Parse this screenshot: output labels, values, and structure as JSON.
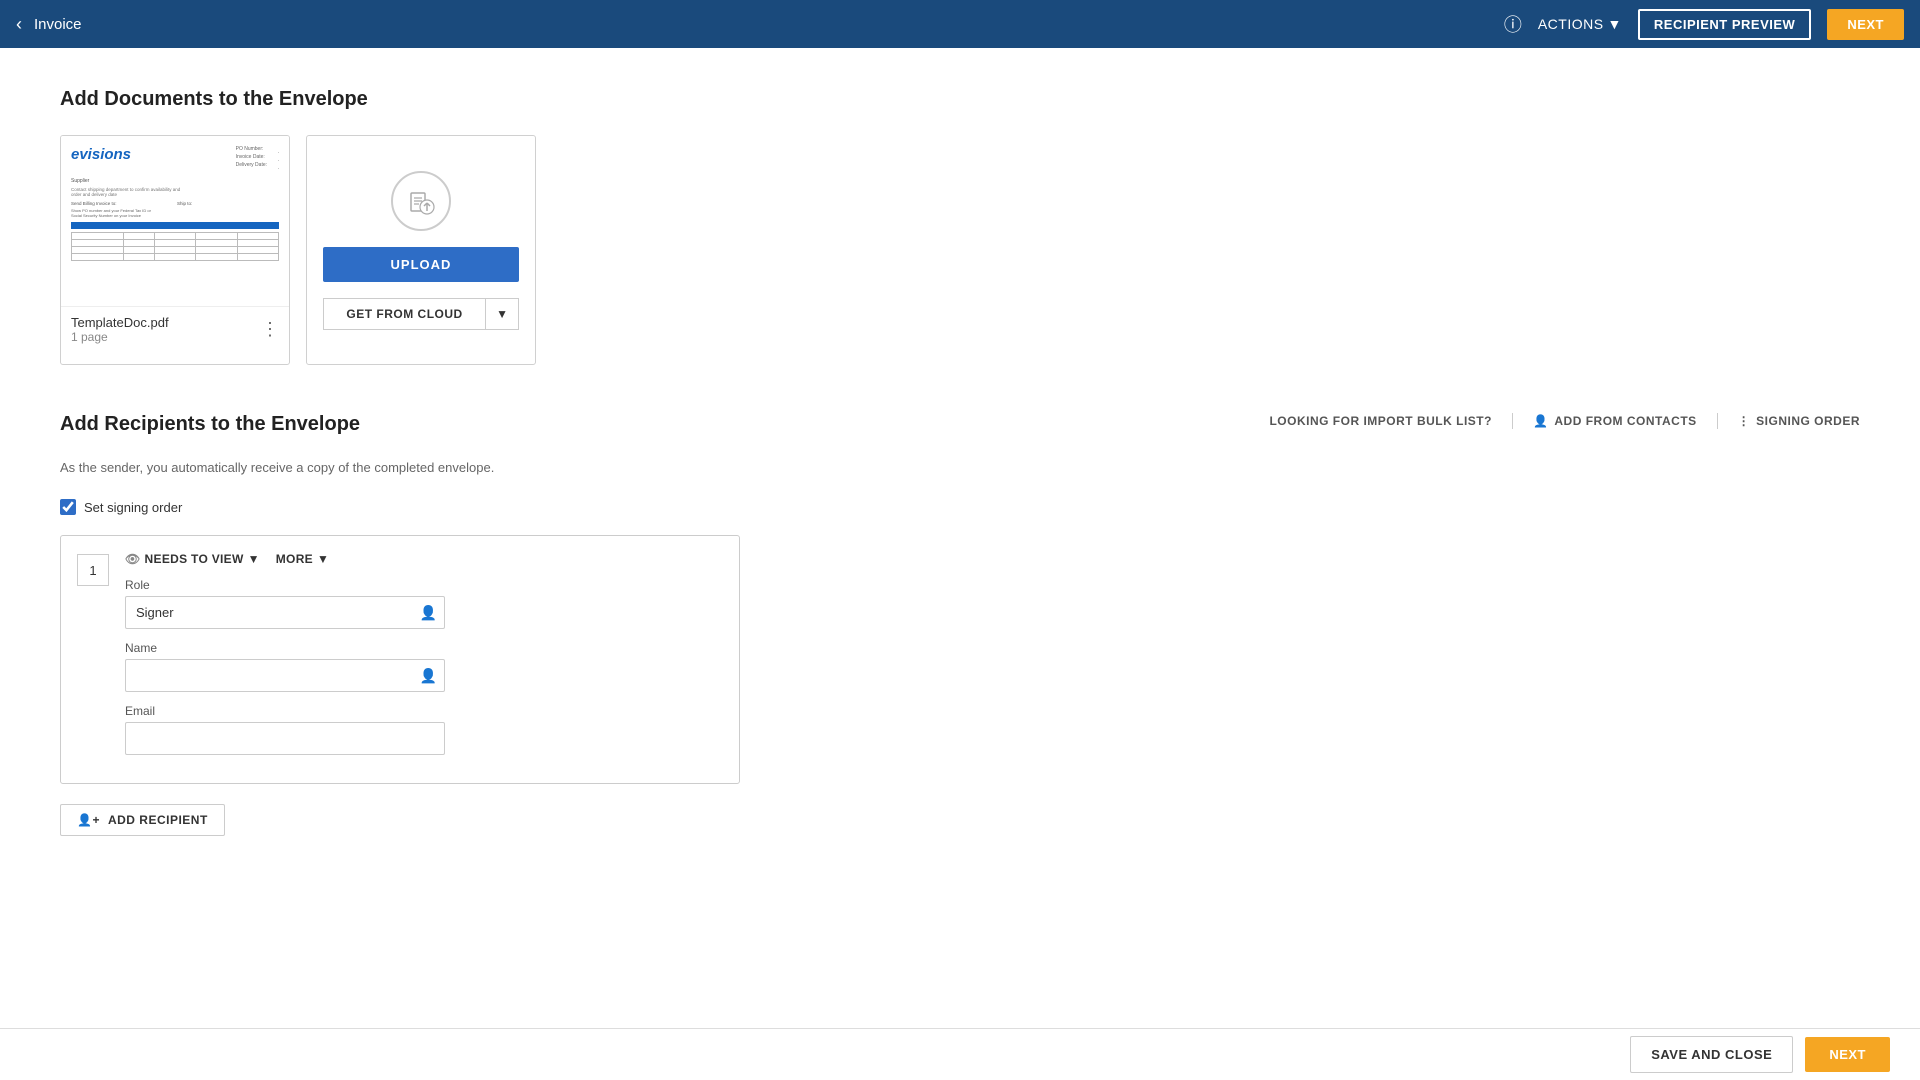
{
  "topnav": {
    "title": "Invoice",
    "actions_label": "ACTIONS",
    "recipient_preview_label": "RECIPIENT PREVIEW",
    "next_label": "NEXT"
  },
  "page": {
    "documents_section_title": "Add Documents to the Envelope",
    "recipients_section_title": "Add Recipients to the Envelope",
    "recipients_subtitle": "As the sender, you automatically receive a copy of the completed envelope.",
    "signing_order_label": "Set signing order"
  },
  "document_card": {
    "name": "TemplateDoc.pdf",
    "pages": "1 page"
  },
  "upload_card": {
    "upload_label": "UPLOAD",
    "get_from_cloud_label": "GET FROM CLOUD"
  },
  "recipients": {
    "looking_for_import": "LOOKING FOR IMPORT BULK LIST?",
    "add_from_contacts_label": "ADD FROM CONTACTS",
    "signing_order_label": "SIGNING ORDER",
    "recipient_number": "1",
    "role_label": "Role",
    "role_value": "Signer",
    "name_label": "Name",
    "name_placeholder": "",
    "email_label": "Email",
    "email_placeholder": "",
    "needs_to_view_label": "NEEDS TO VIEW",
    "more_label": "MORE",
    "add_recipient_label": "ADD RECIPIENT"
  },
  "bottom_bar": {
    "save_and_close_label": "SAVE AND CLOSE",
    "next_label": "NEXT"
  }
}
